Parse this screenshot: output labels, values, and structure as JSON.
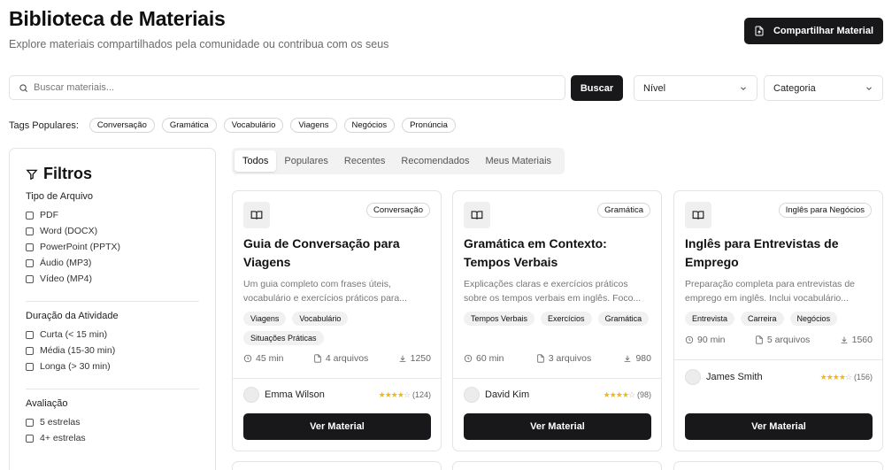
{
  "header": {
    "title": "Biblioteca de Materiais",
    "subtitle": "Explore materiais compartilhados pela comunidade ou contribua com os seus",
    "share_label": "Compartilhar Material"
  },
  "search": {
    "placeholder": "Buscar materiais...",
    "button_label": "Buscar",
    "level_select": "Nível",
    "category_select": "Categoria"
  },
  "popular_tags": {
    "label": "Tags Populares:",
    "items": [
      "Conversação",
      "Gramática",
      "Vocabulário",
      "Viagens",
      "Negócios",
      "Pronúncia"
    ]
  },
  "filters": {
    "title": "Filtros",
    "groups": [
      {
        "title": "Tipo de Arquivo",
        "options": [
          "PDF",
          "Word (DOCX)",
          "PowerPoint (PPTX)",
          "Áudio (MP3)",
          "Vídeo (MP4)"
        ]
      },
      {
        "title": "Duração da Atividade",
        "options": [
          "Curta (< 15 min)",
          "Média (15-30 min)",
          "Longa (> 30 min)"
        ]
      },
      {
        "title": "Avaliação",
        "options": [
          "5 estrelas",
          "4+ estrelas"
        ]
      }
    ]
  },
  "tabs": [
    "Todos",
    "Populares",
    "Recentes",
    "Recomendados",
    "Meus Materiais"
  ],
  "active_tab": "Todos",
  "materials": [
    {
      "category": "Conversação",
      "title": "Guia de Conversação para Viagens",
      "description": "Um guia completo com frases úteis, vocabulário e exercícios práticos para...",
      "tags": [
        "Viagens",
        "Vocabulário",
        "Situações Práticas"
      ],
      "duration": "45 min",
      "files": "4 arquivos",
      "downloads": "1250",
      "author": "Emma Wilson",
      "rating": 4,
      "reviews": "(124)",
      "button": "Ver Material"
    },
    {
      "category": "Gramática",
      "title": "Gramática em Contexto: Tempos Verbais",
      "description": "Explicações claras e exercícios práticos sobre os tempos verbais em inglês. Foco...",
      "tags": [
        "Tempos Verbais",
        "Exercícios",
        "Gramática"
      ],
      "duration": "60 min",
      "files": "3 arquivos",
      "downloads": "980",
      "author": "David Kim",
      "rating": 4,
      "reviews": "(98)",
      "button": "Ver Material"
    },
    {
      "category": "Inglês para Negócios",
      "title": "Inglês para Entrevistas de Emprego",
      "description": "Preparação completa para entrevistas de emprego em inglês. Inclui vocabulário...",
      "tags": [
        "Entrevista",
        "Carreira",
        "Negócios"
      ],
      "duration": "90 min",
      "files": "5 arquivos",
      "downloads": "1560",
      "author": "James Smith",
      "rating": 4,
      "reviews": "(156)",
      "button": "Ver Material"
    }
  ],
  "colors": {
    "primary": "#18181b",
    "star": "#f2b90c",
    "muted_text": "#777777"
  }
}
